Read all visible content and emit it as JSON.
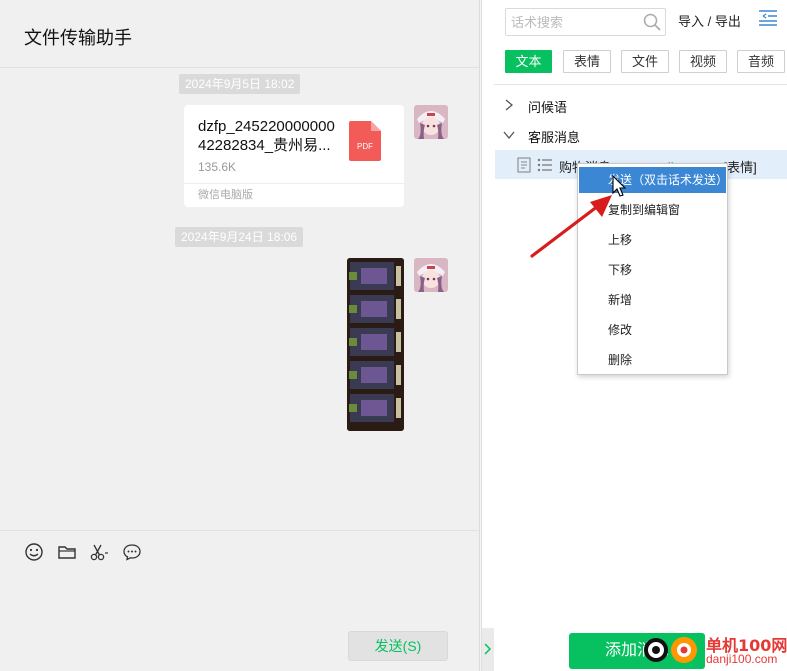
{
  "chat": {
    "title": "文件传输助手",
    "messages": [
      {
        "timestamp": "2024年9月5日 18:02",
        "type": "file",
        "file_name": "dzfp_245220000000 42282834_贵州易...",
        "file_size": "135.6K",
        "file_type_badge": "PDF",
        "source": "微信电脑版"
      },
      {
        "timestamp": "2024年9月24日 18:06",
        "type": "image"
      }
    ],
    "toolbar_icons": [
      "emoji-icon",
      "folder-icon",
      "scissors-icon",
      "chat-bubble-icon"
    ],
    "send_label": "发送(S)"
  },
  "panel": {
    "search_placeholder": "话术搜索",
    "import_label": "导入",
    "separator": "/",
    "export_label": "导出",
    "tabs": [
      "文本",
      "表情",
      "文件",
      "视频",
      "音频"
    ],
    "active_tab": "文本",
    "groups": [
      {
        "label": "问候语",
        "expanded": false
      },
      {
        "label": "客服消息",
        "expanded": true
      }
    ],
    "selected_item": {
      "text": "购物消息",
      "text_right": "...ji100.com[表情]"
    },
    "add_button_label": "添加消息"
  },
  "context_menu": {
    "items": [
      "发送（双击话术发送）",
      "复制到编辑窗",
      "上移",
      "下移",
      "新增",
      "修改",
      "删除"
    ],
    "highlighted_index": 0
  },
  "watermark": {
    "name": "单机100网",
    "url": "danji100.com"
  },
  "colors": {
    "accent_green": "#07c160",
    "menu_highlight": "#3c87d4",
    "annotation_red": "#e53935"
  }
}
